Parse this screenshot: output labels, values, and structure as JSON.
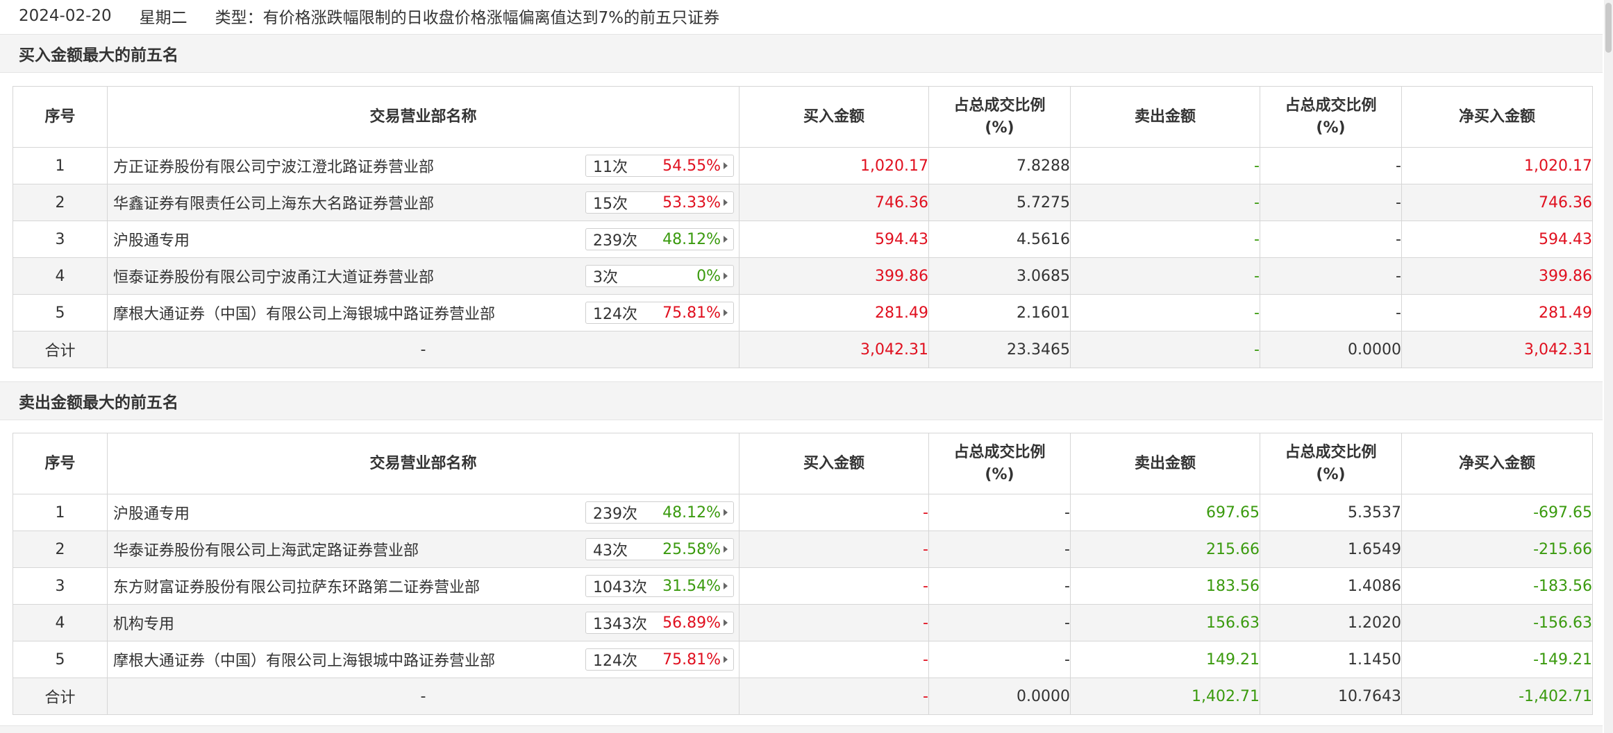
{
  "header": {
    "date": "2024-02-20",
    "weekday": "星期二",
    "type": "类型：有价格涨跌幅限制的日收盘价格涨幅偏离值达到7%的前五只证券"
  },
  "colors": {
    "up": "#e0101f",
    "down": "#3a9a0e",
    "neutral": "#333333"
  },
  "buy_section": {
    "title": "买入金额最大的前五名",
    "columns": {
      "idx": "序号",
      "name": "交易营业部名称",
      "buy": "买入金额",
      "buy_ratio": "占总成交比例\n(%)",
      "sell": "卖出金额",
      "sell_ratio": "占总成交比例\n(%)",
      "net": "净买入金额"
    },
    "rows": [
      {
        "idx": "1",
        "name": "方正证券股份有限公司宁波江澄北路证券营业部",
        "count": "11次",
        "rate": "54.55%",
        "rate_color": "red",
        "buy": "1,020.17",
        "buy_ratio": "7.8288",
        "sell": "-",
        "sell_ratio": "-",
        "net": "1,020.17"
      },
      {
        "idx": "2",
        "name": "华鑫证券有限责任公司上海东大名路证券营业部",
        "count": "15次",
        "rate": "53.33%",
        "rate_color": "red",
        "buy": "746.36",
        "buy_ratio": "5.7275",
        "sell": "-",
        "sell_ratio": "-",
        "net": "746.36"
      },
      {
        "idx": "3",
        "name": "沪股通专用",
        "count": "239次",
        "rate": "48.12%",
        "rate_color": "green",
        "buy": "594.43",
        "buy_ratio": "4.5616",
        "sell": "-",
        "sell_ratio": "-",
        "net": "594.43"
      },
      {
        "idx": "4",
        "name": "恒泰证券股份有限公司宁波甬江大道证券营业部",
        "count": "3次",
        "rate": "0%",
        "rate_color": "green",
        "buy": "399.86",
        "buy_ratio": "3.0685",
        "sell": "-",
        "sell_ratio": "-",
        "net": "399.86"
      },
      {
        "idx": "5",
        "name": "摩根大通证券（中国）有限公司上海银城中路证券营业部",
        "count": "124次",
        "rate": "75.81%",
        "rate_color": "red",
        "buy": "281.49",
        "buy_ratio": "2.1601",
        "sell": "-",
        "sell_ratio": "-",
        "net": "281.49"
      }
    ],
    "total": {
      "label": "合计",
      "name": "-",
      "buy": "3,042.31",
      "buy_ratio": "23.3465",
      "sell": "-",
      "sell_ratio": "0.0000",
      "net": "3,042.31"
    }
  },
  "sell_section": {
    "title": "卖出金额最大的前五名",
    "columns": {
      "idx": "序号",
      "name": "交易营业部名称",
      "buy": "买入金额",
      "buy_ratio": "占总成交比例\n(%)",
      "sell": "卖出金额",
      "sell_ratio": "占总成交比例\n(%)",
      "net": "净买入金额"
    },
    "rows": [
      {
        "idx": "1",
        "name": "沪股通专用",
        "count": "239次",
        "rate": "48.12%",
        "rate_color": "green",
        "buy": "-",
        "buy_ratio": "-",
        "sell": "697.65",
        "sell_ratio": "5.3537",
        "net": "-697.65"
      },
      {
        "idx": "2",
        "name": "华泰证券股份有限公司上海武定路证券营业部",
        "count": "43次",
        "rate": "25.58%",
        "rate_color": "green",
        "buy": "-",
        "buy_ratio": "-",
        "sell": "215.66",
        "sell_ratio": "1.6549",
        "net": "-215.66"
      },
      {
        "idx": "3",
        "name": "东方财富证券股份有限公司拉萨东环路第二证券营业部",
        "count": "1043次",
        "rate": "31.54%",
        "rate_color": "green",
        "buy": "-",
        "buy_ratio": "-",
        "sell": "183.56",
        "sell_ratio": "1.4086",
        "net": "-183.56"
      },
      {
        "idx": "4",
        "name": "机构专用",
        "count": "1343次",
        "rate": "56.89%",
        "rate_color": "red",
        "buy": "-",
        "buy_ratio": "-",
        "sell": "156.63",
        "sell_ratio": "1.2020",
        "net": "-156.63"
      },
      {
        "idx": "5",
        "name": "摩根大通证券（中国）有限公司上海银城中路证券营业部",
        "count": "124次",
        "rate": "75.81%",
        "rate_color": "red",
        "buy": "-",
        "buy_ratio": "-",
        "sell": "149.21",
        "sell_ratio": "1.1450",
        "net": "-149.21"
      }
    ],
    "total": {
      "label": "合计",
      "name": "-",
      "buy": "-",
      "buy_ratio": "0.0000",
      "sell": "1,402.71",
      "sell_ratio": "10.7643",
      "net": "-1,402.71"
    }
  }
}
